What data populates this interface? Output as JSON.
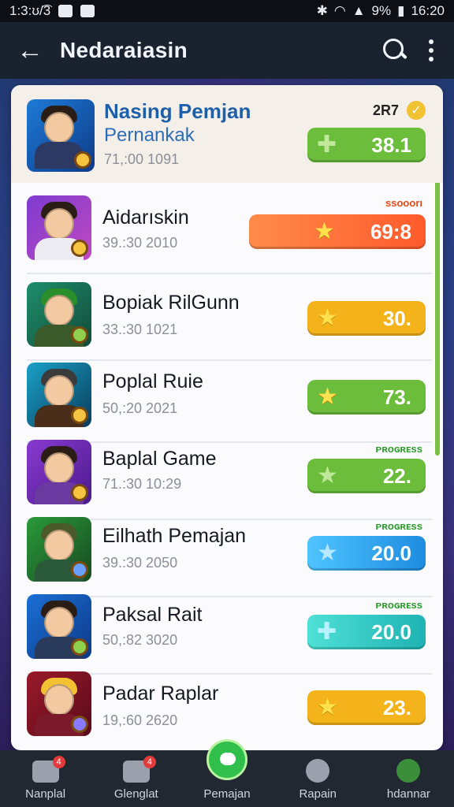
{
  "status": {
    "time_left": "1:3:ʊ/͡3",
    "battery": "9%",
    "time_right": "16:20"
  },
  "appbar": {
    "title": "Nedaraiasin"
  },
  "featured": {
    "name": "Nasing Pemjan",
    "subtitle": "Pernankak",
    "meta": "71,:00 1091",
    "count_label": "2R7",
    "value": "38.1",
    "color": "#6cbd3b"
  },
  "rows": [
    {
      "name": "Aidarıskin",
      "meta": "39.:30 2010",
      "value": "69:8",
      "label": "ssooorı",
      "color": "#ff6a34",
      "label_color": "#e64a19"
    },
    {
      "name": "Bopiak RilGunn",
      "meta": "33.:30 1021",
      "value": "30.",
      "label": "",
      "color": "#f4b31a",
      "label_color": ""
    },
    {
      "name": "Poplal Ruie",
      "meta": "50,:20 2021",
      "value": "73.",
      "label": "",
      "color": "#6cbd3b",
      "label_color": ""
    },
    {
      "name": "Baplal Game",
      "meta": "71.:30 10:29",
      "value": "22.",
      "label": "ᴘʀᴏɢʀᴇss",
      "color": "#6cbd3b",
      "label_color": "#2e9b2e"
    },
    {
      "name": "Eilhath Pemajan",
      "meta": "39.:30 2050",
      "value": "20.0",
      "label": "ᴘʀᴏɢʀᴇss",
      "color": "#2fa8ee",
      "label_color": "#2e9b2e"
    },
    {
      "name": "Paksal Rait",
      "meta": "50,:82 3020",
      "value": "20.0",
      "label": "ᴘʀᴏɢʀᴇss",
      "color": "#25c7c7",
      "label_color": "#2e9b2e"
    },
    {
      "name": "Padar Raplar",
      "meta": "19,:60 2620",
      "value": "23.",
      "label": "",
      "color": "#f4b31a",
      "label_color": ""
    }
  ],
  "bottom_nav": [
    {
      "label": "Nanplal",
      "badge": "4",
      "icon": "camera-icon"
    },
    {
      "label": "Glenglat",
      "badge": "4",
      "icon": "document-icon"
    },
    {
      "label": "Pemajan",
      "badge": "",
      "icon": "chat-icon"
    },
    {
      "label": "Rapain",
      "badge": "",
      "icon": "profile-icon"
    },
    {
      "label": "hdannar",
      "badge": "",
      "icon": "trend-icon"
    }
  ]
}
